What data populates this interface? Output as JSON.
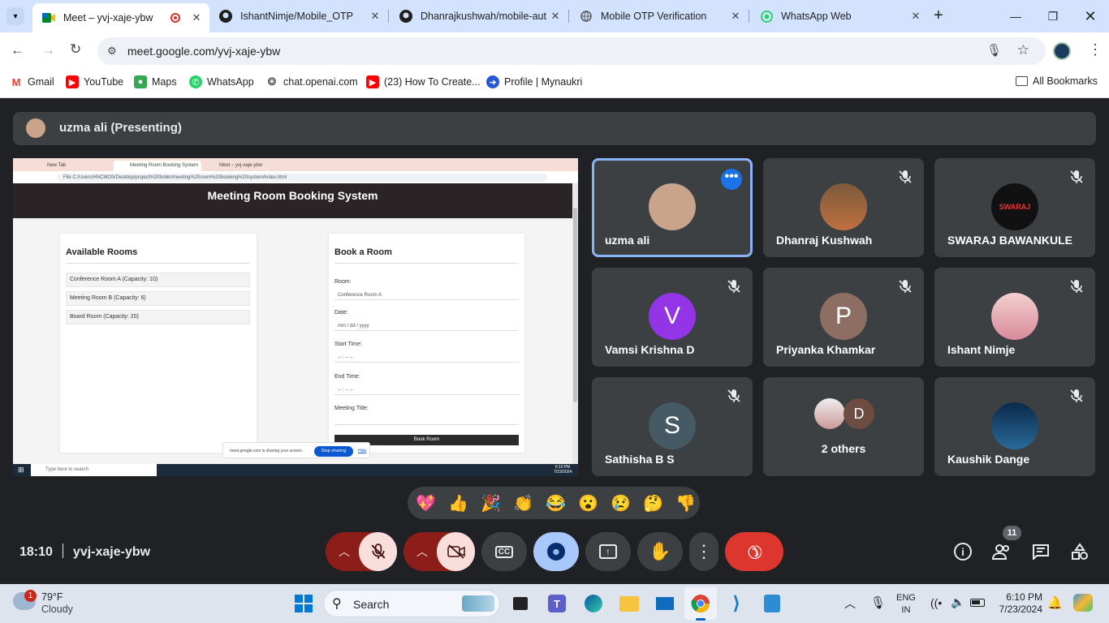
{
  "browser": {
    "tabs": [
      {
        "title": "Meet – yvj-xaje-ybw",
        "active": true
      },
      {
        "title": "IshantNimje/Mobile_OTP"
      },
      {
        "title": "Dhanrajkushwah/mobile-aut"
      },
      {
        "title": "Mobile OTP Verification"
      },
      {
        "title": "WhatsApp Web"
      }
    ],
    "url": "meet.google.com/yvj-xaje-ybw",
    "bookmarks": [
      "Gmail",
      "YouTube",
      "Maps",
      "WhatsApp",
      "chat.openai.com",
      "(23) How To Create...",
      "Profile | Mynaukri"
    ],
    "all_bookmarks": "All Bookmarks"
  },
  "meet": {
    "presenting_label": "uzma ali (Presenting)",
    "time": "18:10",
    "code": "yvj-xaje-ybw",
    "participants_count": "11",
    "participants": [
      {
        "name": "uzma ali",
        "speaking": true
      },
      {
        "name": "Dhanraj Kushwah"
      },
      {
        "name": "SWARAJ BAWANKULE"
      },
      {
        "name": "Vamsi Krishna D",
        "initial": "V",
        "color": "#9334e6"
      },
      {
        "name": "Priyanka Khamkar",
        "initial": "P",
        "color": "#8d6e63"
      },
      {
        "name": "Ishant Nimje"
      },
      {
        "name": "Sathisha B S",
        "initial": "S",
        "color": "#455a64"
      },
      {
        "name": "2 others",
        "initial": "D"
      },
      {
        "name": "Kaushik Dange"
      }
    ],
    "reactions": [
      "💖",
      "👍",
      "🎉",
      "👏",
      "😂",
      "😮",
      "😢",
      "🤔",
      "👎"
    ]
  },
  "shared": {
    "tabs": [
      "New Tab",
      "Meeting Room Booking System",
      "Meet – yvj-xaje-ybw"
    ],
    "file_url": "File   C:/Users/HNCMOS/Desktop/project%20folder/meeting%20room%20booking%20system/index.html",
    "header": "Meeting Room Booking System",
    "available_title": "Available Rooms",
    "rooms": [
      "Conference Room A (Capacity: 10)",
      "Meeting Room B (Capacity: 6)",
      "Board Room (Capacity: 20)"
    ],
    "book_title": "Book a Room",
    "labels": {
      "room": "Room:",
      "date": "Date:",
      "start": "Start Time:",
      "end": "End Time:",
      "title": "Meeting Title:"
    },
    "room_value": "Conference Room A",
    "date_value": "mm / dd / yyyy",
    "time_value": "-- : -- --",
    "book_button": "Book Room",
    "share_text": "meet.google.com is sharing your screen.",
    "stop_sharing": "Stop sharing",
    "hide": "Hide",
    "search_placeholder": "Type here to search",
    "clock_time": "6:10 PM",
    "clock_date": "7/23/2024"
  },
  "taskbar": {
    "weather_temp": "79°F",
    "weather_desc": "Cloudy",
    "weather_badge": "1",
    "search": "Search",
    "lang": "ENG",
    "region": "IN",
    "time": "6:10 PM",
    "date": "7/23/2024"
  }
}
